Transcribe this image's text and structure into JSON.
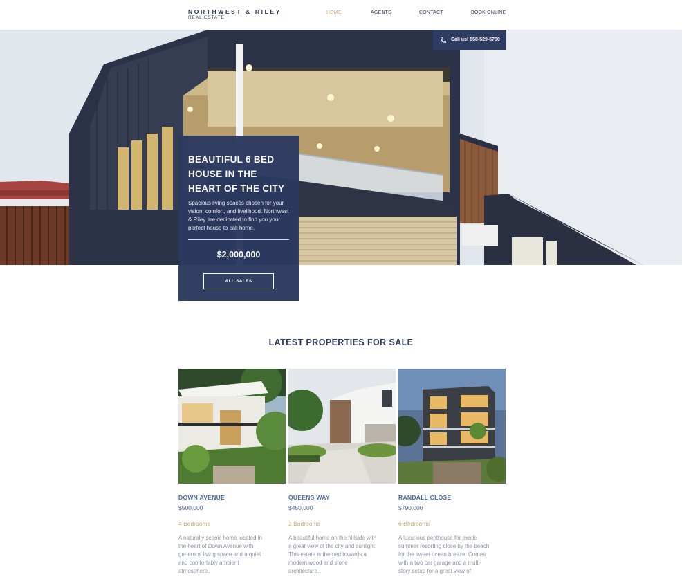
{
  "header": {
    "logo_name": "NORTHWEST & RILEY",
    "logo_sub": "REAL ESTATE",
    "nav": [
      {
        "label": "HOME",
        "active": true
      },
      {
        "label": "AGENTS",
        "active": false
      },
      {
        "label": "CONTACT",
        "active": false
      },
      {
        "label": "BOOK ONLINE",
        "active": false
      }
    ]
  },
  "hero": {
    "call_label": "Call us! 858-529-6730",
    "promo_title": "BEAUTIFUL 6 BED HOUSE IN THE HEART OF THE CITY",
    "promo_description": "Spacious living spaces chosen for your vision, comfort, and livelihood. Northwest & Riley are dedicated to find you your perfect house to call home.",
    "price": "$2,000,000",
    "button_label": "ALL SALES"
  },
  "listings": {
    "title": "LATEST PROPERTIES FOR SALE",
    "items": [
      {
        "name": "DOWN AVENUE",
        "price": "$500,000",
        "bedrooms": "4 Bedrooms",
        "description": "A naturally scenic home located in the heart of Down Avenue with generous living space and a quiet and comfortably ambient atmosphere."
      },
      {
        "name": "QUEENS WAY",
        "price": "$450,000",
        "bedrooms": "3 Bedrooms",
        "description": "A beautiful home on the hillside with a great view of the city and sunlight. This estate is themed towards a modern wood and stone architecture."
      },
      {
        "name": "RANDALL CLOSE",
        "price": "$790,000",
        "bedrooms": "6 Bedrooms",
        "description": "A luxurious penthouse for exotic summer resorting close by the beach for the sweet ocean breeze. Comes with a two car garage and a multi-story setup for a great view of"
      }
    ]
  },
  "colors": {
    "navy": "#2c3a60",
    "accent_gold": "#c9a77b",
    "link_blue": "#4a66a8",
    "body_gray": "#8e96a4"
  },
  "icons": {
    "call": "phone-icon"
  }
}
